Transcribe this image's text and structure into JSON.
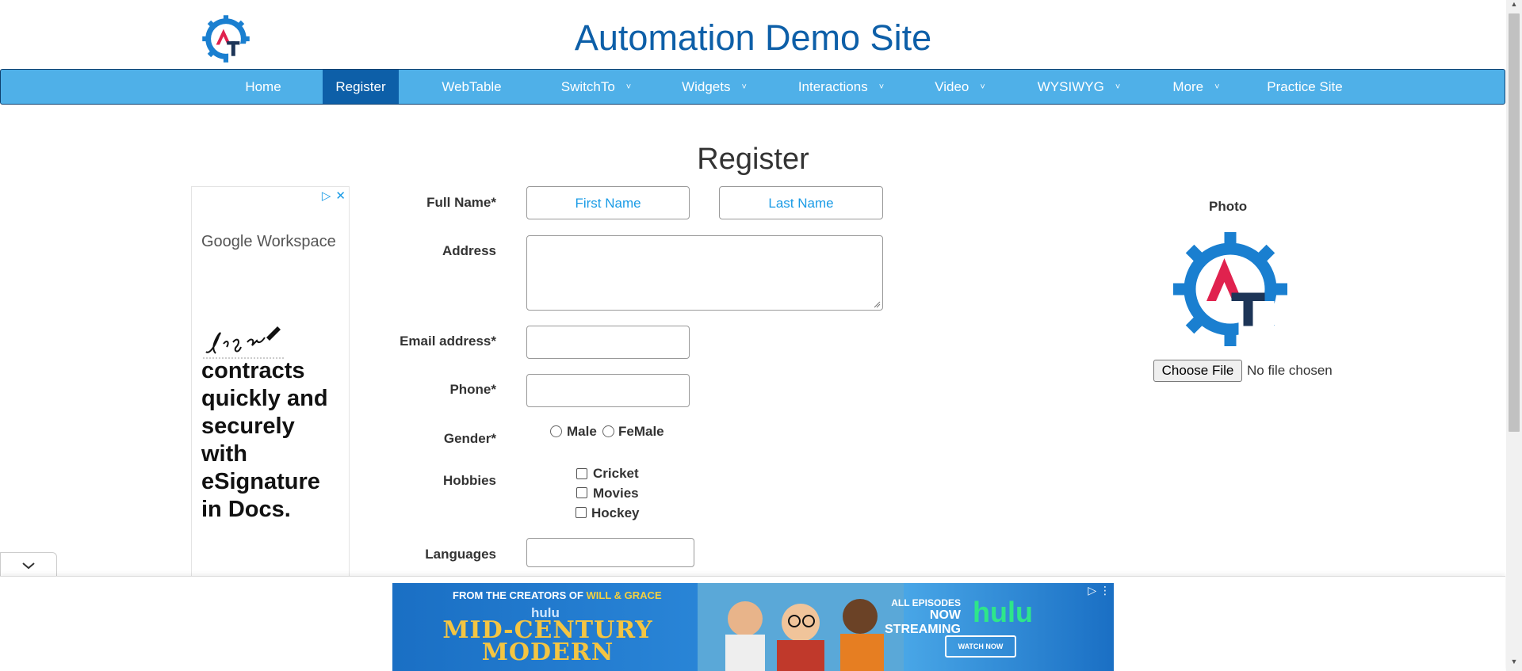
{
  "header": {
    "site_title": "Automation Demo Site"
  },
  "nav": {
    "items": [
      {
        "label": "Home"
      },
      {
        "label": "Register"
      },
      {
        "label": "WebTable"
      },
      {
        "label": "SwitchTo"
      },
      {
        "label": "Widgets"
      },
      {
        "label": "Interactions"
      },
      {
        "label": "Video"
      },
      {
        "label": "WYSIWYG"
      },
      {
        "label": "More"
      },
      {
        "label": "Practice Site"
      }
    ],
    "active": "Register",
    "chevron": "˅"
  },
  "page": {
    "title": "Register"
  },
  "form": {
    "full_name_label": "Full Name*",
    "first_name_placeholder": "First Name",
    "last_name_placeholder": "Last Name",
    "address_label": "Address",
    "email_label": "Email address*",
    "phone_label": "Phone*",
    "gender_label": "Gender*",
    "gender_options": [
      "Male",
      "FeMale"
    ],
    "hobbies_label": "Hobbies",
    "hobbies_options": [
      "Cricket",
      "Movies",
      "Hockey"
    ],
    "languages_label": "Languages"
  },
  "photo": {
    "label": "Photo",
    "choose_file": "Choose File",
    "status": "No file chosen"
  },
  "ad_left": {
    "brand_google": "Google",
    "brand_workspace": "Workspace",
    "headline": "contracts quickly and securely with eSignature in Docs.",
    "icons": [
      "adchoices-icon",
      "close-icon"
    ]
  },
  "ad_bottom": {
    "line1_prefix": "FROM THE CREATORS OF",
    "line1_highlight": "WILL & GRACE",
    "hulu_small": "hulu",
    "title_line1": "MID-CENTURY",
    "title_line2": "MODERN",
    "all_episodes": "ALL EPISODES",
    "now_streaming": "NOW STREAMING",
    "hulu": "hulu",
    "watch_now": "WATCH NOW"
  },
  "colors": {
    "nav_bg": "#4fb0e8",
    "nav_active": "#0d5fa8",
    "title": "#0d5fa8",
    "placeholder": "#1a9be6",
    "logo_blue": "#1a7fd0",
    "logo_red": "#e0224e",
    "logo_navy": "#1d3557"
  }
}
